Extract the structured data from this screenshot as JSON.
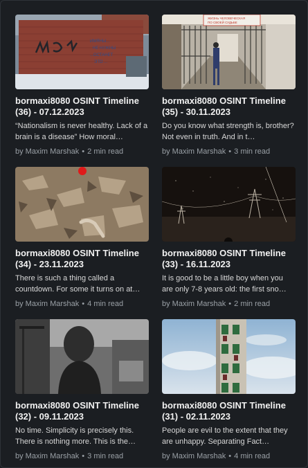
{
  "posts": [
    {
      "title": "bormaxi8080 OSINT Timeline (36) - 07.12.2023",
      "excerpt": "“Nationalism is never healthy. Lack of a brain is a disease” How moral…",
      "author": "by Maxim Marshak",
      "sep": "•",
      "read_time": "2 min read",
      "image_label": "graffiti-wall-image"
    },
    {
      "title": "bormaxi8080 OSINT Timeline (35) - 30.11.2023",
      "excerpt": "Do you know what strength is, brother? Not even in truth. And in t…",
      "author": "by Maxim Marshak",
      "sep": "•",
      "read_time": "3 min read",
      "image_label": "prison-corridor-image"
    },
    {
      "title": "bormaxi8080 OSINT Timeline (34) - 23.11.2023",
      "excerpt": "There is such a thing called a countdown. For some it turns on at…",
      "author": "by Maxim Marshak",
      "sep": "•",
      "read_time": "4 min read",
      "image_label": "rubble-image"
    },
    {
      "title": "bormaxi8080 OSINT Timeline (33) - 16.11.2023",
      "excerpt": "It is good to be a little boy when you are only 7-8 years old: the first sno…",
      "author": "by Maxim Marshak",
      "sep": "•",
      "read_time": "2 min read",
      "image_label": "power-lines-night-image"
    },
    {
      "title": "bormaxi8080 OSINT Timeline (32) - 09.11.2023",
      "excerpt": "No time. Simplicity is precisely this. There is nothing more. This is the…",
      "author": "by Maxim Marshak",
      "sep": "•",
      "read_time": "3 min read",
      "image_label": "woman-back-image"
    },
    {
      "title": "bormaxi8080 OSINT Timeline (31) - 02.11.2023",
      "excerpt": "People are evil to the extent that they are unhappy. Separating Fact…",
      "author": "by Maxim Marshak",
      "sep": "•",
      "read_time": "4 min read",
      "image_label": "tower-sky-image"
    }
  ]
}
